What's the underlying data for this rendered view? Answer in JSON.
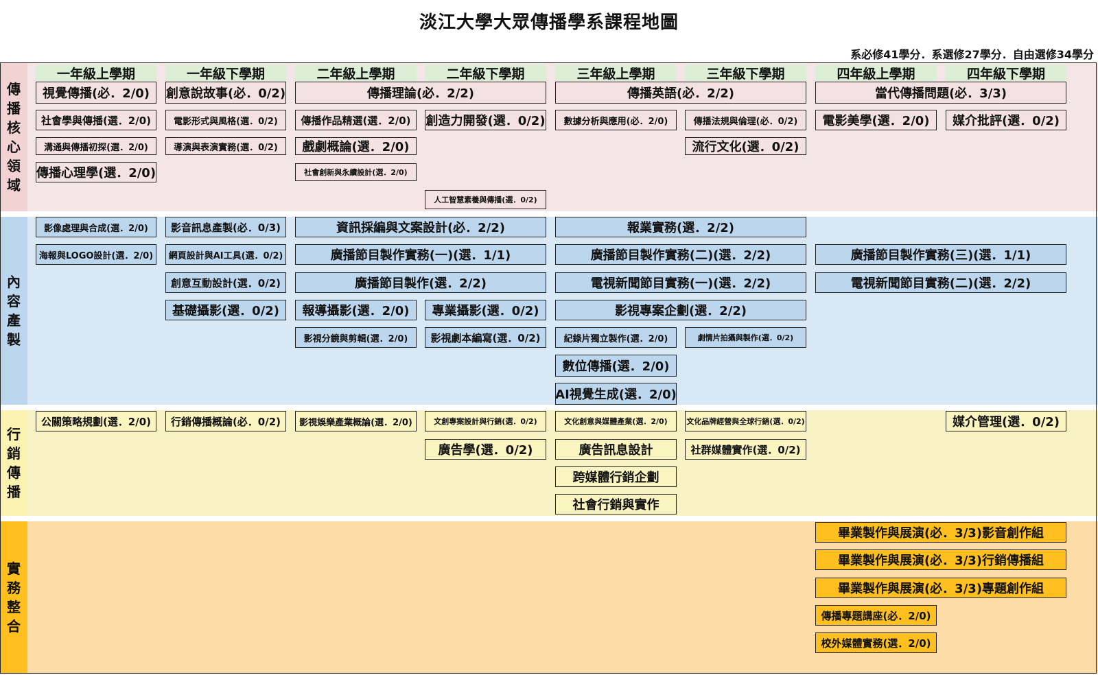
{
  "title": "淡江大學大眾傳播學系課程地圖",
  "credits": "系必修41學分．系選修27學分．自由選修34學分",
  "semesters": [
    "一年級上學期",
    "一年級下學期",
    "二年級上學期",
    "二年級下學期",
    "三年級上學期",
    "三年級下學期",
    "四年級上學期",
    "四年級下學期"
  ],
  "colors": {
    "core_bg": "#f4e6e6",
    "core_label": "#f2d2d2",
    "content_bg": "#d9e8f5",
    "content_label": "#bcd6ee",
    "marketing_bg": "#f8f3c4",
    "marketing_label": "#fbf1b0",
    "practice_bg": "#fddca8",
    "practice_label": "#ffc01f",
    "semester_header": "#dcefd6"
  },
  "areas": [
    {
      "label": "傳播核心領域",
      "courses": [
        "視覺傳播(必．2/0)",
        "創意說故事(必．0/2)",
        "傳播理論(必．2/2)",
        "傳播英語(必．2/2)",
        "當代傳播問題(必．3/3)",
        "社會學與傳播(選．2/0)",
        "電影形式與風格(選．0/2)",
        "傳播作品精選(選．2/0)",
        "創造力開發(選．0/2)",
        "數據分析與應用(必．2/0)",
        "傳播法規與倫理(必．0/2)",
        "電影美學(選．2/0)",
        "媒介批評(選．0/2)",
        "溝通與傳播初探(選．2/0)",
        "導演與表演實務(選．0/2)",
        "戲劇概論(選．2/0)",
        "流行文化(選．0/2)",
        "傳播心理學(選．2/0)",
        "社會創新與永續設計(選．2/0)",
        "人工智慧素養與傳播(選．0/2)"
      ]
    },
    {
      "label": "內容產製",
      "courses": [
        "影像處理與合成(選．2/0)",
        "影音訊息產製(必．0/3)",
        "資訊採編與文案設計(必．2/2)",
        "報業實務(選．2/2)",
        "海報與LOGO設計(選．2/0)",
        "網頁設計與AI工具(選．0/2)",
        "廣播節目製作實務(一)(選．1/1)",
        "廣播節目製作實務(二)(選．2/2)",
        "廣播節目製作實務(三)(選．1/1)",
        "創意互動設計(選．0/2)",
        "廣播節目製作(選．2/2)",
        "電視新聞節目實務(一)(選．2/2)",
        "電視新聞節目實務(二)(選．2/2)",
        "基礎攝影(選．0/2)",
        "報導攝影(選．2/0)",
        "專業攝影(選．0/2)",
        "影視專案企劃(選．2/2)",
        "影視分鏡與剪輯(選．2/0)",
        "影視劇本編寫(選．0/2)",
        "紀錄片獨立製作(選．2/0)",
        "劇情片拍攝與製作(選．0/2)",
        "數位傳播(選．2/0)",
        "AI視覺生成(選．2/0)"
      ]
    },
    {
      "label": "行銷傳播",
      "courses": [
        "公關策略規劃(選．2/0)",
        "行銷傳播概論(必．0/2)",
        "影視娛樂產業概論(選．2/0)",
        "文創專案設計與行銷(選．0/2)",
        "文化創意與媒體產業(選．2/0)",
        "文化品牌經營與全球行銷(選．0/2)",
        "媒介管理(選．0/2)",
        "廣告學(選．0/2)",
        "廣告訊息設計",
        "社群媒體實作(選．0/2)",
        "跨媒體行銷企劃",
        "社會行銷與實作"
      ]
    },
    {
      "label": "實務整合",
      "courses": [
        "畢業製作與展演(必．3/3)影音創作組",
        "畢業製作與展演(必．3/3)行銷傳播組",
        "畢業製作與展演(必．3/3)專題創作組",
        "傳播專題講座(必．2/0)",
        "校外媒體實務(選．2/0)"
      ]
    }
  ]
}
